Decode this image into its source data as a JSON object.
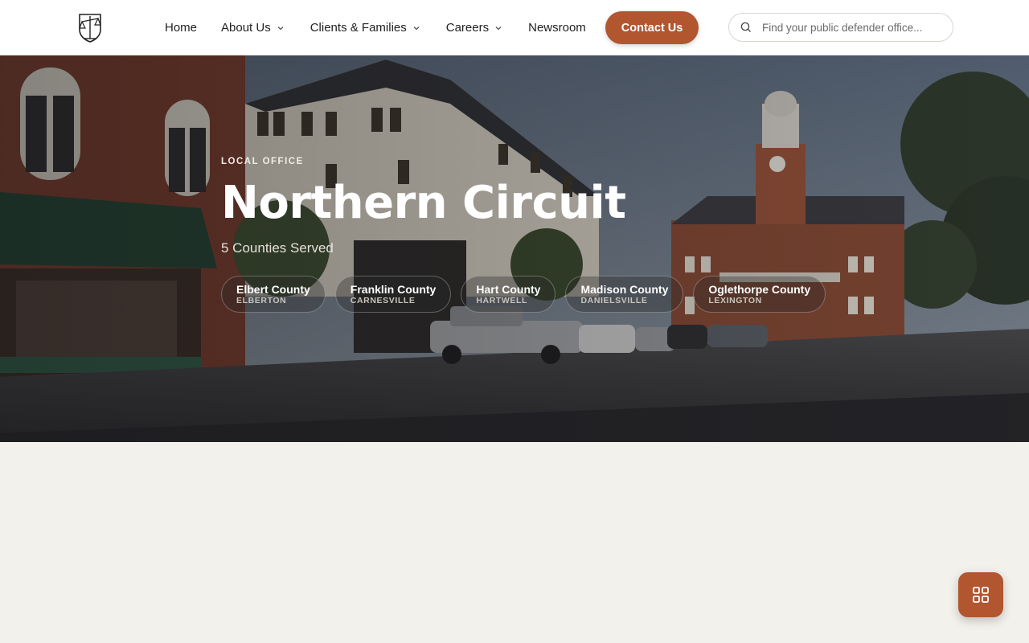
{
  "header": {
    "logo_icon": "scales-shield-logo-icon",
    "nav": [
      {
        "label": "Home",
        "has_dropdown": false
      },
      {
        "label": "About Us",
        "has_dropdown": true
      },
      {
        "label": "Clients & Families",
        "has_dropdown": true
      },
      {
        "label": "Careers",
        "has_dropdown": true
      },
      {
        "label": "Newsroom",
        "has_dropdown": false
      }
    ],
    "contact_label": "Contact Us",
    "search": {
      "placeholder": "Find your public defender office...",
      "value": "",
      "icon": "search-icon"
    }
  },
  "hero": {
    "eyebrow": "LOCAL OFFICE",
    "title": "Northern Circuit",
    "counties_served": "5 Counties Served",
    "counties": [
      {
        "name": "Elbert County",
        "city": "ELBERTON"
      },
      {
        "name": "Franklin County",
        "city": "CARNESVILLE"
      },
      {
        "name": "Hart County",
        "city": "HARTWELL"
      },
      {
        "name": "Madison County",
        "city": "DANIELSVILLE"
      },
      {
        "name": "Oglethorpe County",
        "city": "LEXINGTON"
      }
    ]
  },
  "fab": {
    "icon": "grid-menu-icon"
  },
  "colors": {
    "accent": "#b25630",
    "background": "#f3f1ec",
    "header": "#ffffff"
  }
}
